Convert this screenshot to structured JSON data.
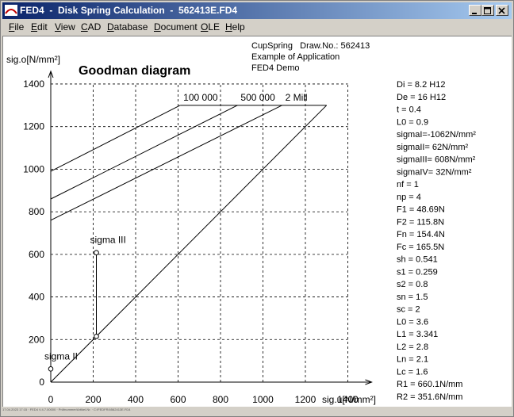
{
  "window": {
    "title": "FED4  -  Disk Spring Calculation  -  562413E.FD4",
    "status_text": "17.04.2023 17:15 · FED4 V.4.7.00000 · Prüfnummer/Artikel-Nr. · C:\\FEDFR4\\562413E.FD4"
  },
  "menu": [
    {
      "first": "F",
      "rest": "ile"
    },
    {
      "first": "E",
      "rest": "dit"
    },
    {
      "first": "V",
      "rest": "iew"
    },
    {
      "first": "C",
      "rest": "AD"
    },
    {
      "first": "D",
      "rest": "atabase"
    },
    {
      "first": "D",
      "rest": "ocument"
    },
    {
      "first": "O",
      "rest": "LE"
    },
    {
      "first": "H",
      "rest": "elp"
    }
  ],
  "header": {
    "line1": "CupSpring   Draw.No.: 562413",
    "line2": "Example of Application",
    "line3": "FED4 Demo"
  },
  "params": [
    "Di = 8.2 H12",
    "De = 16 H12",
    "t = 0.4",
    "L0 = 0.9",
    "sigmaI=-1062N/mm²",
    "sigmaII=  62N/mm²",
    "sigmaIII= 608N/mm²",
    "sigmaIV=  32N/mm²",
    "nf =    1",
    "np =    4",
    "F1 = 48.69N",
    "F2 = 115.8N",
    "Fn = 154.4N",
    "Fc = 165.5N",
    "sh = 0.541",
    "s1 = 0.259",
    "s2 = 0.8",
    "sn = 1.5",
    "sc = 2",
    "L0 = 3.6",
    "L1 = 3.341",
    "L2 = 2.8",
    "Ln = 2.1",
    "Lc = 1.6",
    "R1 = 660.1N/mm",
    "R2 = 351.6N/mm"
  ],
  "chart_data": {
    "type": "line",
    "title": "Goodman diagram",
    "xlabel": "sig.u[N/mm²]",
    "ylabel": "sig.o[N/mm²]",
    "xlim": [
      0,
      1400
    ],
    "ylim": [
      0,
      1400
    ],
    "xticks": [
      0,
      200,
      400,
      600,
      800,
      1000,
      1200,
      1400
    ],
    "yticks": [
      0,
      200,
      400,
      600,
      800,
      1000,
      1200,
      1400
    ],
    "grid": true,
    "lines": [
      {
        "name": "100 000",
        "points": [
          [
            0,
            990
          ],
          [
            610,
            1300
          ]
        ]
      },
      {
        "name": "500 000",
        "points": [
          [
            0,
            860
          ],
          [
            880,
            1300
          ]
        ]
      },
      {
        "name": "2 Mill",
        "points": [
          [
            0,
            760
          ],
          [
            1090,
            1300
          ]
        ]
      }
    ],
    "diagonal": [
      [
        0,
        0
      ],
      [
        1300,
        1300
      ]
    ],
    "limit_top": [
      [
        610,
        1300
      ],
      [
        1300,
        1300
      ]
    ],
    "stroke": [
      [
        215,
        215
      ],
      [
        215,
        608
      ]
    ],
    "points": [
      {
        "label": "sigma II",
        "x": 0,
        "y": 62
      },
      {
        "label": "",
        "x": 215,
        "y": 215
      },
      {
        "label": "sigma III",
        "x": 215,
        "y": 608
      }
    ]
  }
}
